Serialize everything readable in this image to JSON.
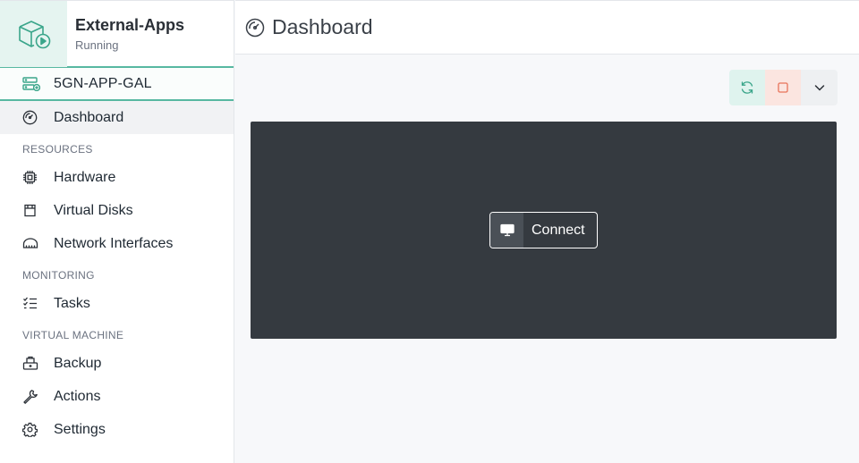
{
  "app": {
    "name": "External-Apps",
    "status": "Running",
    "icon": "cube-play-icon"
  },
  "server": {
    "label": "5GN-APP-GAL",
    "icon": "server-add-icon"
  },
  "sidebar": {
    "dashboard": {
      "label": "Dashboard",
      "icon": "gauge-icon"
    },
    "sections": [
      {
        "title": "RESOURCES",
        "items": [
          {
            "label": "Hardware",
            "icon": "chip-icon"
          },
          {
            "label": "Virtual Disks",
            "icon": "disk-icon"
          },
          {
            "label": "Network Interfaces",
            "icon": "network-icon"
          }
        ]
      },
      {
        "title": "MONITORING",
        "items": [
          {
            "label": "Tasks",
            "icon": "tasks-icon"
          }
        ]
      },
      {
        "title": "VIRTUAL MACHINE",
        "items": [
          {
            "label": "Backup",
            "icon": "backup-icon"
          },
          {
            "label": "Actions",
            "icon": "wrench-icon"
          },
          {
            "label": "Settings",
            "icon": "gear-icon"
          }
        ]
      }
    ]
  },
  "header": {
    "title": "Dashboard",
    "icon": "gauge-icon"
  },
  "toolbar": {
    "refresh_icon": "refresh-icon",
    "stop_icon": "stop-icon",
    "more_icon": "chevron-down-icon"
  },
  "console": {
    "connect_label": "Connect",
    "connect_icon": "monitor-icon"
  },
  "colors": {
    "accent": "#57b8a1",
    "console_bg": "#353a40",
    "stop": "#e8735a"
  }
}
